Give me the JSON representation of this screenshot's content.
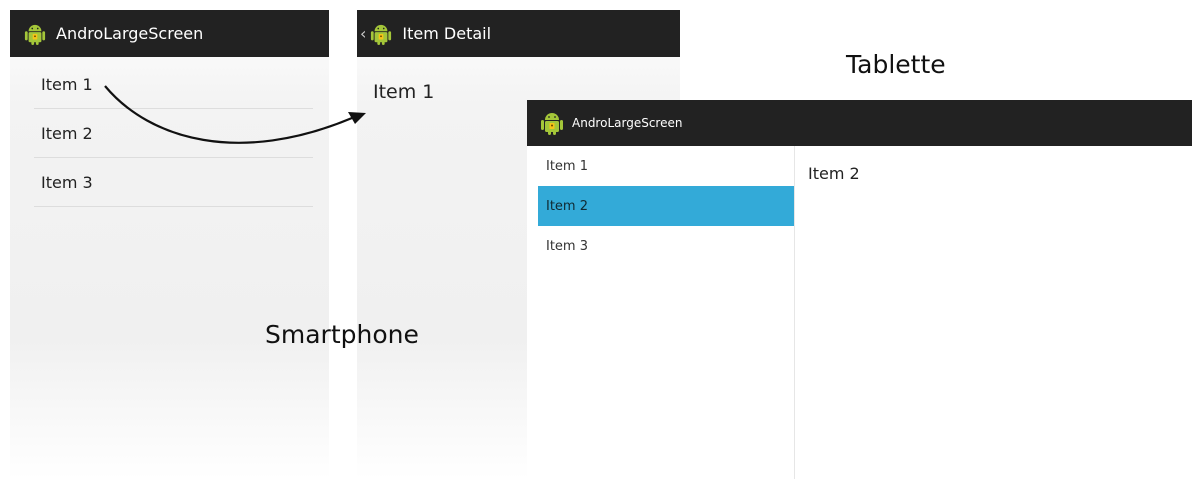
{
  "phone_master": {
    "app_title": "AndroLargeScreen",
    "items": [
      "Item 1",
      "Item 2",
      "Item 3"
    ]
  },
  "phone_detail": {
    "bar_title": "Item Detail",
    "content": "Item 1"
  },
  "tablet": {
    "app_title": "AndroLargeScreen",
    "items": [
      "Item 1",
      "Item 2",
      "Item 3"
    ],
    "selected_index": 1,
    "detail": "Item 2"
  },
  "captions": {
    "smartphone": "Smartphone",
    "tablet": "Tablette"
  },
  "icons": {
    "app": "android-app-icon",
    "up": "up-caret-icon",
    "arrow": "navigation-arrow"
  },
  "colors": {
    "actionbar": "#222222",
    "selection": "#33aad8",
    "android_green": "#a4c639"
  }
}
